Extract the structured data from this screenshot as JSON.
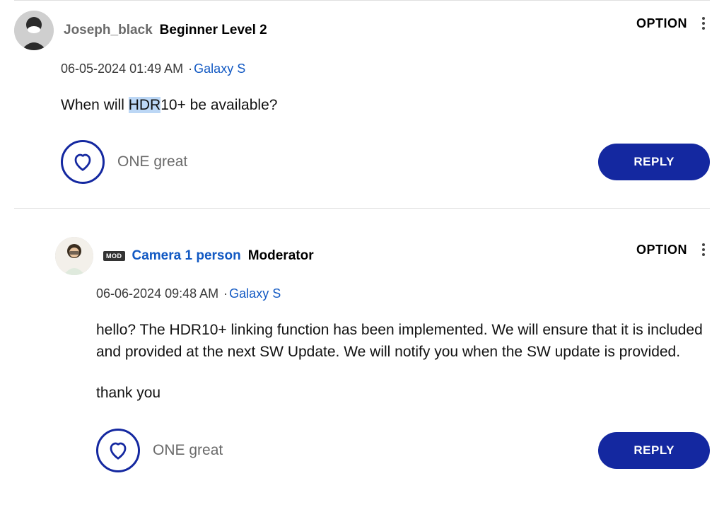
{
  "option_label": "OPTION",
  "reply_label": "REPLY",
  "like_text": "ONE great",
  "posts": [
    {
      "username": "Joseph_black",
      "rank": "Beginner Level 2",
      "date": "06-05-2024",
      "time": "01:49 AM",
      "topic": "Galaxy S",
      "body_pre": "When will ",
      "body_hl": "HDR",
      "body_post": "10+ be available?"
    },
    {
      "mod_badge": "MOD",
      "username": "Camera 1 person",
      "rank": "Moderator",
      "date": "06-06-2024",
      "time": "09:48 AM",
      "topic": "Galaxy S",
      "body_p1": "hello? The HDR10+ linking function has been implemented. We will ensure that it is included and provided at the next SW Update. We will notify you when the SW update is provided.",
      "body_p2": "thank you"
    }
  ]
}
